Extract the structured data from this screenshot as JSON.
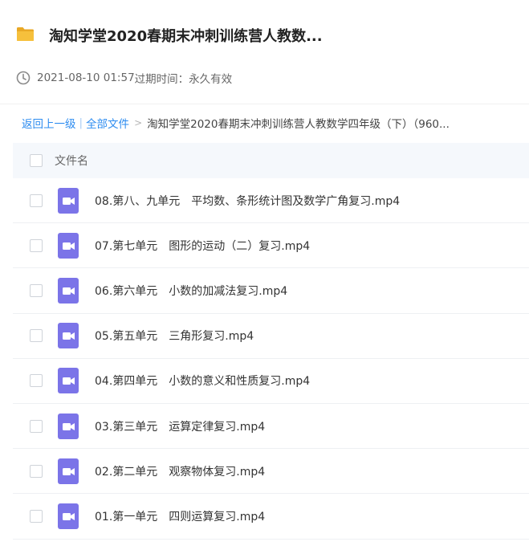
{
  "header": {
    "title": "淘知学堂2020春期末冲刺训练营人教数...",
    "date": "2021-08-10 01:57",
    "expiry_label": "过期时间：永久有效"
  },
  "breadcrumb": {
    "back": "返回上一级",
    "separator": "|",
    "all_files": "全部文件",
    "arrow": ">",
    "current": "淘知学堂2020春期末冲刺训练营人教数学四年级（下）（960..."
  },
  "table": {
    "column_name": "文件名",
    "rows": [
      {
        "name": "08.第八、九单元　平均数、条形统计图及数学广角复习.mp4"
      },
      {
        "name": "07.第七单元　图形的运动（二）复习.mp4"
      },
      {
        "name": "06.第六单元　小数的加减法复习.mp4"
      },
      {
        "name": "05.第五单元　三角形复习.mp4"
      },
      {
        "name": "04.第四单元　小数的意义和性质复习.mp4"
      },
      {
        "name": "03.第三单元　运算定律复习.mp4"
      },
      {
        "name": "02.第二单元　观察物体复习.mp4"
      },
      {
        "name": "01.第一单元　四则运算复习.mp4"
      }
    ]
  },
  "icons": {
    "folder": "folder-icon",
    "clock": "clock-icon",
    "video": "video-file-icon"
  },
  "colors": {
    "link": "#2d8cf0",
    "video_icon": "#7b74e8",
    "folder": "#f6c03c",
    "header_bg": "#f5f8fc"
  }
}
